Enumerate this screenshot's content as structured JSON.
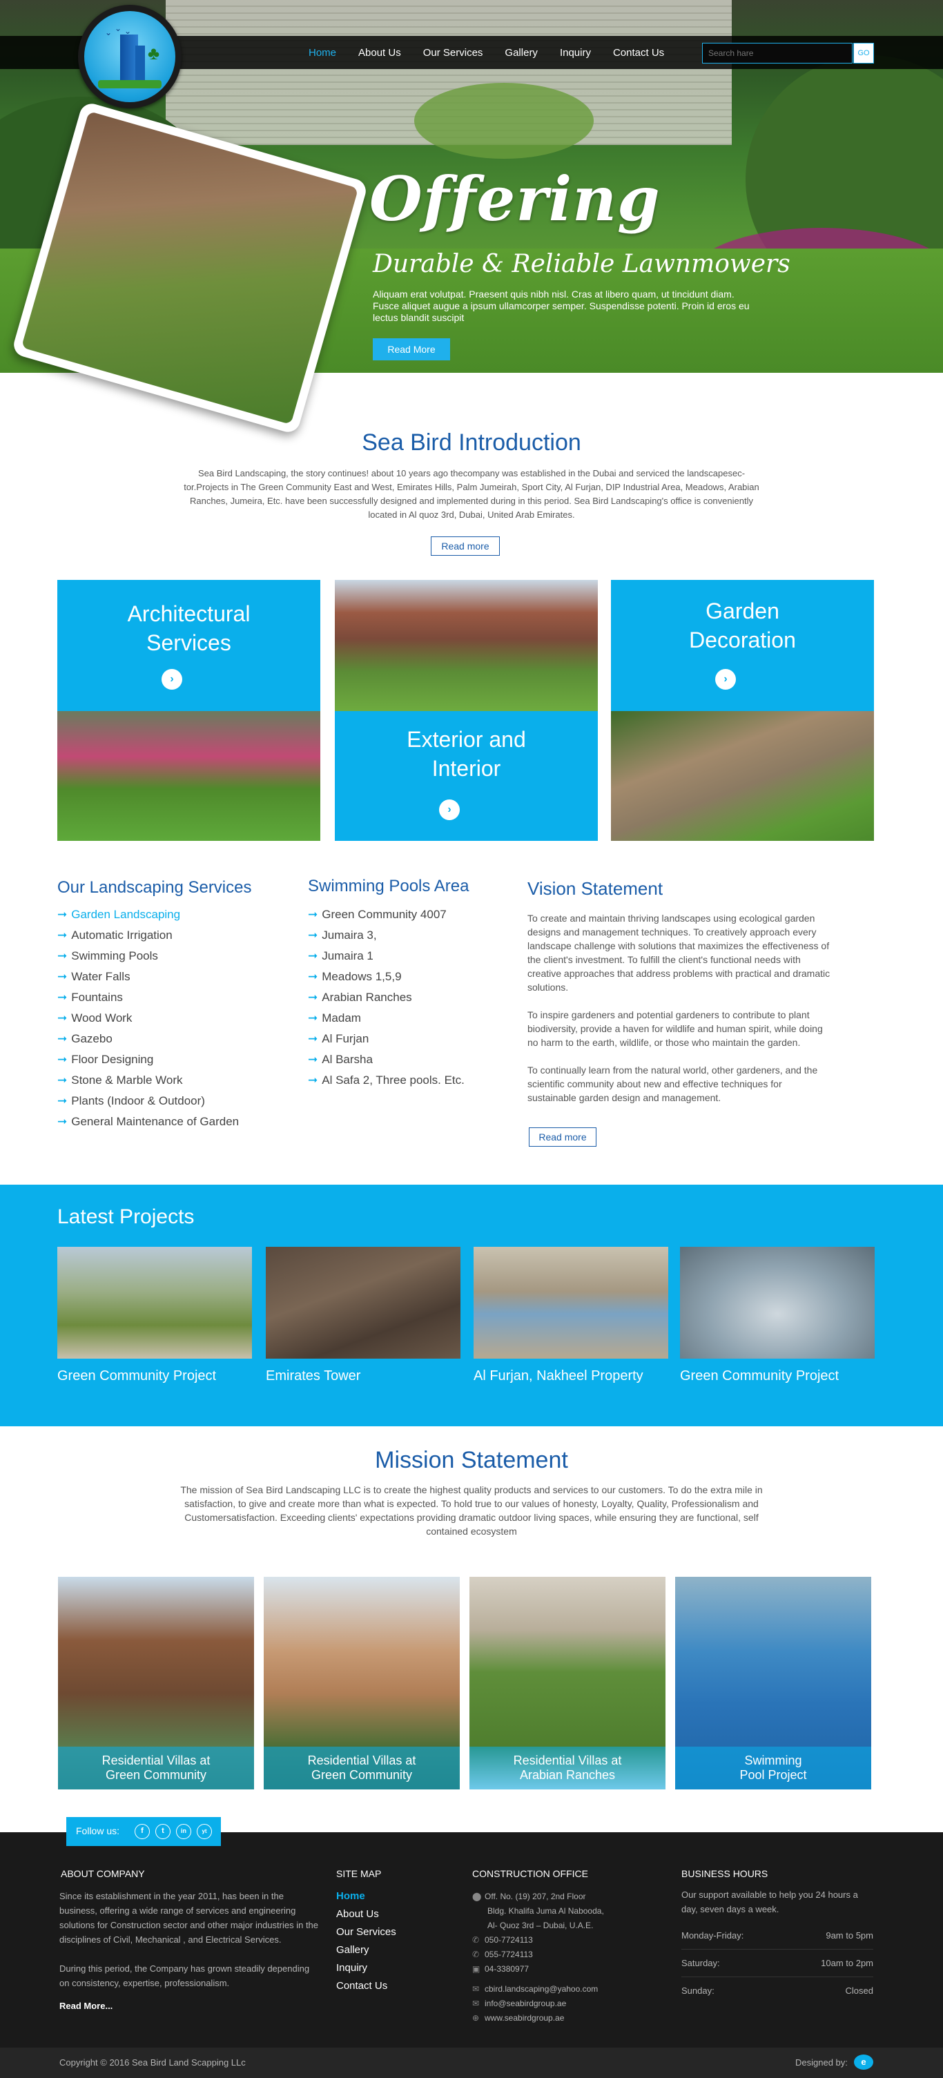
{
  "nav": {
    "items": [
      {
        "label": "Home",
        "active": true
      },
      {
        "label": "About Us"
      },
      {
        "label": "Our Services"
      },
      {
        "label": "Gallery"
      },
      {
        "label": "Inquiry"
      },
      {
        "label": "Contact Us"
      }
    ],
    "search_placeholder": "Search hare",
    "search_button": "GO"
  },
  "hero": {
    "title": "Offering",
    "subtitle": "Durable & Reliable Lawnmowers",
    "text": "Aliquam erat volutpat. Praesent quis nibh nisl. Cras at libero quam, ut tincidunt diam. Fusce aliquet augue a ipsum ullamcorper semper. Suspendisse potenti. Proin id eros eu lectus blandit suscipit",
    "button": "Read More"
  },
  "intro": {
    "title": "Sea Bird Introduction",
    "text": "Sea Bird Landscaping, the story continues! about 10 years ago thecompany was established in the Dubai and serviced the landscapesec-tor.Projects in The Green Community East and West, Emirates Hills, Palm Jumeirah, Sport City, Al Furjan, DIP Industrial Area, Meadows, Arabian Ranches, Jumeira, Etc. have been successfully designed and implemented during in this period. Sea Bird Landscaping's office is conveniently located in Al quoz 3rd, Dubai, United Arab Emirates.",
    "button": "Read more"
  },
  "cards": [
    {
      "title": "Architectural Services"
    },
    {
      "title": "Exterior and Interior"
    },
    {
      "title": "Garden Decoration"
    }
  ],
  "landscaping": {
    "title": "Our Landscaping Services",
    "items": [
      "Garden Landscaping",
      "Automatic Irrigation",
      "Swimming Pools",
      "Water Falls",
      "Fountains",
      "Wood Work",
      "Gazebo",
      "Floor Designing",
      "Stone & Marble Work",
      "Plants (Indoor & Outdoor)",
      "General Maintenance of Garden"
    ]
  },
  "pools": {
    "title": "Swimming Pools Area",
    "items": [
      "Green Community 4007",
      "Jumaira 3,",
      "Jumaira 1",
      "Meadows 1,5,9",
      "Arabian Ranches",
      "Madam",
      "Al Furjan",
      "Al Barsha",
      "Al Safa 2, Three pools. Etc."
    ]
  },
  "vision": {
    "title": "Vision Statement",
    "paragraphs": [
      "To create and maintain thriving landscapes using ecological garden designs and management techniques. To creatively approach every landscape challenge with solutions that maximizes the effectiveness of the client's investment. To fulfill the client's functional needs with creative approaches that address problems with practical and dramatic solutions.",
      "To inspire gardeners and potential gardeners to contribute to plant biodiversity, provide a haven for wildlife and human spirit, while doing no harm to the earth, wildlife, or those who maintain the garden.",
      "To continually learn from the natural world, other gardeners, and the scientific community about new and effective techniques for sustainable garden design and management."
    ],
    "button": "Read more"
  },
  "latest": {
    "title": "Latest Projects",
    "projects": [
      {
        "caption": "Green Community Project"
      },
      {
        "caption": "Emirates Tower"
      },
      {
        "caption": "Al Furjan, Nakheel Property"
      },
      {
        "caption": "Green Community Project"
      }
    ]
  },
  "mission": {
    "title": "Mission Statement",
    "text": "The mission of Sea Bird Landscaping LLC is to create the highest quality products and services to our customers. To do the extra mile in satisfaction, to give and create more than what is expected. To hold true to our values of honesty, Loyalty, Quality, Professionalism and Customersatisfaction. Exceeding clients' expectations providing dramatic outdoor living spaces, while ensuring they are functional, self contained ecosystem",
    "villas": [
      {
        "line1": "Residential Villas at",
        "line2": "Green Community"
      },
      {
        "line1": "Residential Villas at",
        "line2": "Green Community"
      },
      {
        "line1": "Residential Villas at",
        "line2": "Arabian Ranches"
      },
      {
        "line1": "Swimming",
        "line2": "Pool Project"
      }
    ]
  },
  "footer": {
    "follow": "Follow us:",
    "social": [
      "f",
      "t",
      "in",
      "yt"
    ],
    "about_title": "ABOUT COMPANY",
    "about_p1": "Since its establishment in the year 2011, has been in the business, offering a wide range of services and engineering solutions for Construction sector and other major industries in the disciplines of Civil, Mechanical , and Electrical Services.",
    "about_p2": "During this period, the Company has grown steadily depending on consistency, expertise, professionalism.",
    "read_more": "Read More...",
    "sitemap_title": "SITE MAP",
    "sitemap": [
      "Home",
      "About Us",
      "Our Services",
      "Gallery",
      "Inquiry",
      "Contact Us"
    ],
    "office_title": "CONSTRUCTION OFFICE",
    "address1": "Off. No. (19) 207, 2nd Floor",
    "address2": "Bldg. Khalifa Juma Al Nabooda,",
    "address3": "Al- Quoz 3rd – Dubai, U.A.E.",
    "phone1": "050-7724113",
    "phone2": "055-7724113",
    "fax": "04-3380977",
    "email1": "cbird.landscaping@yahoo.com",
    "email2": "info@seabirdgroup.ae",
    "web": "www.seabirdgroup.ae",
    "hours_title": "BUSINESS HOURS",
    "hours_text": "Our support available to help you 24 hours a day, seven days a week.",
    "hours": [
      {
        "day": "Monday-Friday:",
        "time": "9am to 5pm"
      },
      {
        "day": "Saturday:",
        "time": "10am to 2pm"
      },
      {
        "day": "Sunday:",
        "time": "Closed"
      }
    ],
    "copyright": "Copyright © 2016 Sea Bird Land Scapping LLc",
    "designed_by": "Designed by:"
  },
  "colors": {
    "accent": "#0aafeb",
    "heading": "#1a5ca8",
    "footer": "#1a1a1a"
  }
}
